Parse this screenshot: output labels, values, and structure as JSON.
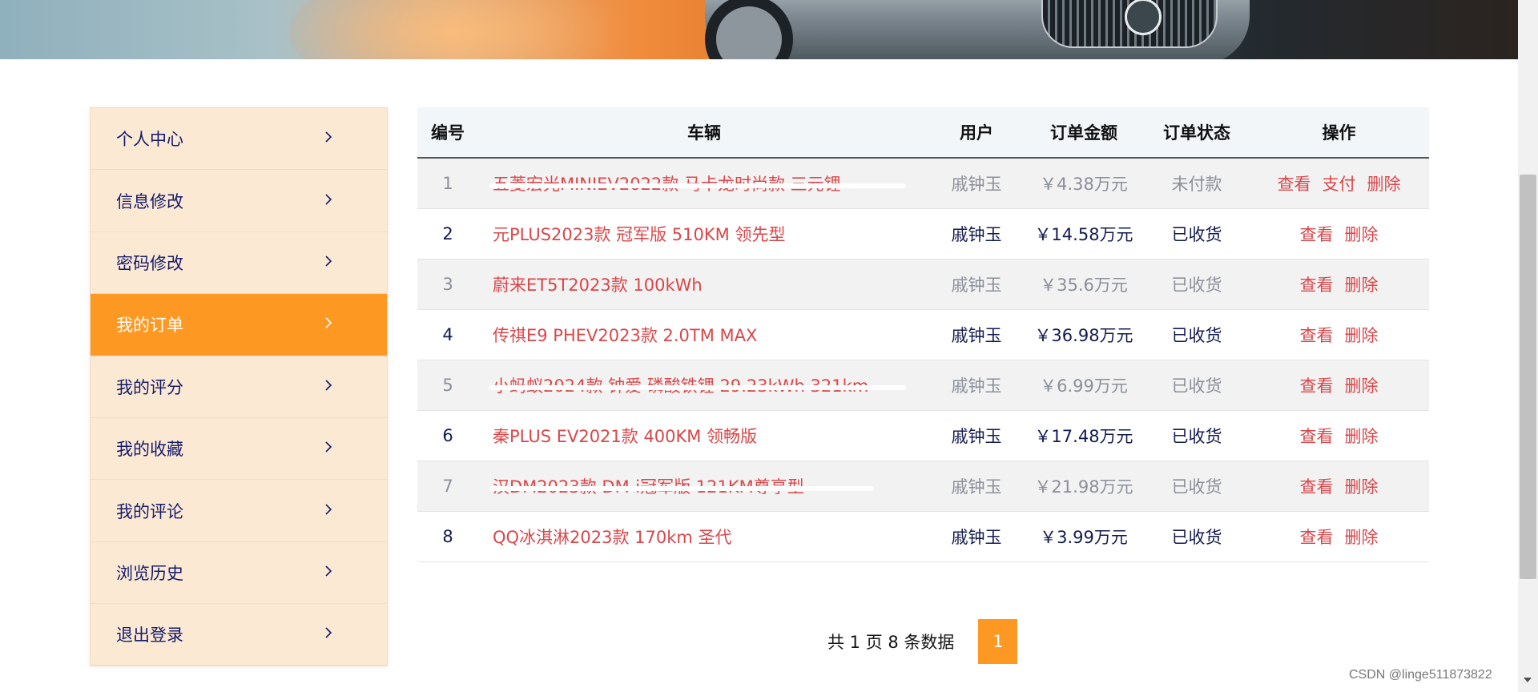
{
  "sidebar": {
    "items": [
      {
        "label": "个人中心",
        "active": false
      },
      {
        "label": "信息修改",
        "active": false
      },
      {
        "label": "密码修改",
        "active": false
      },
      {
        "label": "我的订单",
        "active": true
      },
      {
        "label": "我的评分",
        "active": false
      },
      {
        "label": "我的收藏",
        "active": false
      },
      {
        "label": "我的评论",
        "active": false
      },
      {
        "label": "浏览历史",
        "active": false
      },
      {
        "label": "退出登录",
        "active": false
      }
    ]
  },
  "table": {
    "headers": [
      "编号",
      "车辆",
      "用户",
      "订单金额",
      "订单状态",
      "操作"
    ],
    "rows": [
      {
        "id": "1",
        "vehicle": "五菱宏光MINIEV2022款 马卡龙时尚款 三元锂",
        "user": "戚钟玉",
        "amount": "￥4.38万元",
        "status": "未付款",
        "actions": [
          "查看",
          "支付",
          "删除"
        ]
      },
      {
        "id": "2",
        "vehicle": "元PLUS2023款 冠军版 510KM 领先型",
        "user": "戚钟玉",
        "amount": "￥14.58万元",
        "status": "已收货",
        "actions": [
          "查看",
          "删除"
        ]
      },
      {
        "id": "3",
        "vehicle": "蔚来ET5T2023款 100kWh",
        "user": "戚钟玉",
        "amount": "￥35.6万元",
        "status": "已收货",
        "actions": [
          "查看",
          "删除"
        ]
      },
      {
        "id": "4",
        "vehicle": "传祺E9 PHEV2023款 2.0TM MAX",
        "user": "戚钟玉",
        "amount": "￥36.98万元",
        "status": "已收货",
        "actions": [
          "查看",
          "删除"
        ]
      },
      {
        "id": "5",
        "vehicle": "小蚂蚁2024款 钟爱 磷酸铁锂 29.23kWh 321km",
        "user": "戚钟玉",
        "amount": "￥6.99万元",
        "status": "已收货",
        "actions": [
          "查看",
          "删除"
        ]
      },
      {
        "id": "6",
        "vehicle": "秦PLUS EV2021款 400KM 领畅版",
        "user": "戚钟玉",
        "amount": "￥17.48万元",
        "status": "已收货",
        "actions": [
          "查看",
          "删除"
        ]
      },
      {
        "id": "7",
        "vehicle": "汉DM2023款 DM-i冠军版 121KM尊享型",
        "user": "戚钟玉",
        "amount": "￥21.98万元",
        "status": "已收货",
        "actions": [
          "查看",
          "删除"
        ]
      },
      {
        "id": "8",
        "vehicle": "QQ冰淇淋2023款 170km 圣代",
        "user": "戚钟玉",
        "amount": "￥3.99万元",
        "status": "已收货",
        "actions": [
          "查看",
          "删除"
        ]
      }
    ]
  },
  "pagination": {
    "info": "共 1 页 8 条数据",
    "current_page": "1"
  },
  "watermark": "CSDN @linge511873822",
  "colors": {
    "accent": "#fd9823",
    "sidebar_bg": "#fbe9d4",
    "link": "#d9474a",
    "nav_text": "#141b6b"
  }
}
